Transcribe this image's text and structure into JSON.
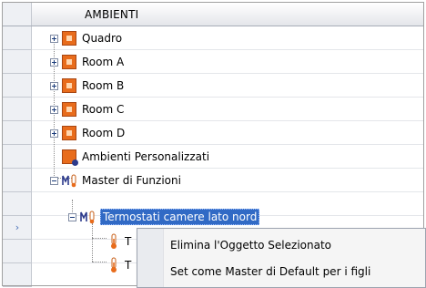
{
  "tree": {
    "header": "AMBIENTI",
    "items": [
      {
        "label": "Quadro",
        "icon": "room-icon",
        "expander": "plus"
      },
      {
        "label": "Room A",
        "icon": "room-icon",
        "expander": "plus"
      },
      {
        "label": "Room B",
        "icon": "room-icon",
        "expander": "plus"
      },
      {
        "label": "Room C",
        "icon": "room-icon",
        "expander": "plus"
      },
      {
        "label": "Room D",
        "icon": "room-icon",
        "expander": "plus"
      },
      {
        "label": "Ambienti Personalizzati",
        "icon": "custom-room-icon"
      },
      {
        "label": "Master di Funzioni",
        "icon": "master-function-icon",
        "expander": "minus"
      },
      {
        "label": "Termostati camere lato nord",
        "icon": "master-function-icon",
        "expander": "minus",
        "selected": true
      },
      {
        "label": "T",
        "icon": "thermostat-icon"
      },
      {
        "label": "T",
        "icon": "thermostat-icon"
      }
    ],
    "row_indicator": "›"
  },
  "context_menu": {
    "items": [
      {
        "label": "Elimina l'Oggetto Selezionato"
      },
      {
        "label": "Set come Master di Default per i figli"
      }
    ]
  },
  "colors": {
    "room_icon": "#e86c1c",
    "selection": "#316ac5",
    "gutter": "#eef0f4"
  }
}
